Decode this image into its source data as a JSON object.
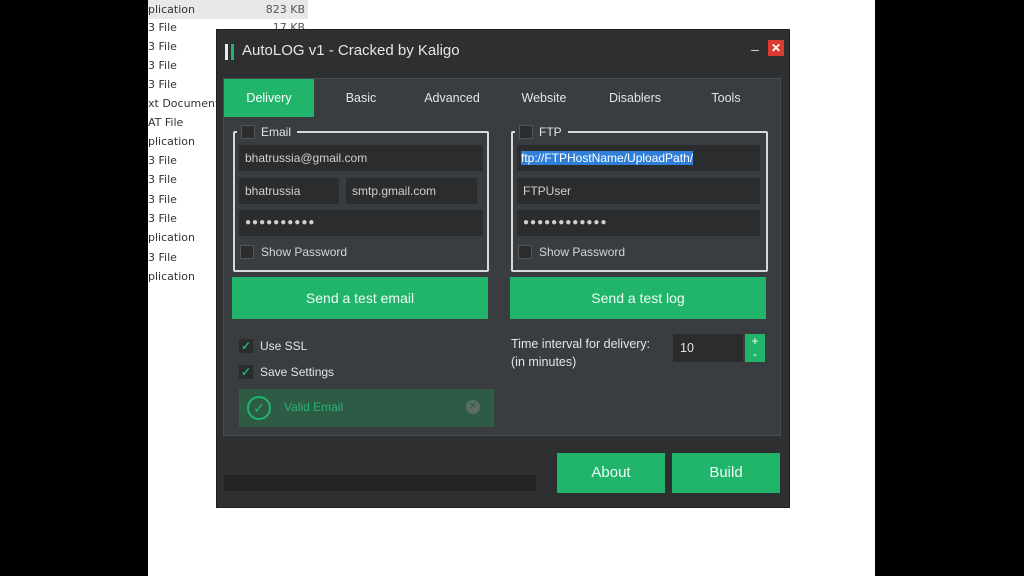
{
  "explorer": {
    "rows": [
      {
        "name": "plication",
        "size": "823 KB"
      },
      {
        "name": "3 File",
        "size": "17 KB"
      },
      {
        "name": "3 File",
        "size": ""
      },
      {
        "name": "3 File",
        "size": ""
      },
      {
        "name": "3 File",
        "size": ""
      },
      {
        "name": "xt Document",
        "size": ""
      },
      {
        "name": "AT File",
        "size": ""
      },
      {
        "name": "plication",
        "size": ""
      },
      {
        "name": "3 File",
        "size": ""
      },
      {
        "name": "3 File",
        "size": ""
      },
      {
        "name": "3 File",
        "size": ""
      },
      {
        "name": "3 File",
        "size": ""
      },
      {
        "name": "plication",
        "size": ""
      },
      {
        "name": "3 File",
        "size": ""
      },
      {
        "name": "plication",
        "size": ""
      }
    ]
  },
  "window": {
    "title": "AutoLOG v1 - Cracked by Kaligo",
    "minimize_glyph": "–",
    "close_glyph": "✕"
  },
  "tabs": [
    "Delivery",
    "Basic",
    "Advanced",
    "Website",
    "Disablers",
    "Tools"
  ],
  "email": {
    "legend": "Email",
    "address": "bhatrussia@gmail.com",
    "username": "bhatrussia",
    "smtp": "smtp.gmail.com",
    "password_mask": "●●●●●●●●●●",
    "show_password": "Show Password",
    "test_button": "Send a test email"
  },
  "ftp": {
    "legend": "FTP",
    "host": "ftp://FTPHostName/UploadPath/",
    "user": "FTPUser",
    "password_mask": "●●●●●●●●●●●●",
    "show_password": "Show Password",
    "test_button": "Send a test log"
  },
  "options": {
    "use_ssl": "Use SSL",
    "save_settings": "Save Settings",
    "check_glyph": "✓"
  },
  "status": {
    "valid_email": "Valid Email",
    "valid_icon": "✓",
    "dismiss_icon": "✕"
  },
  "interval": {
    "label_line1": "Time interval for delivery:",
    "label_line2": "(in minutes)",
    "value": "10",
    "plus": "+",
    "minus": "-"
  },
  "footer": {
    "about": "About",
    "build": "Build"
  },
  "colors": {
    "accent": "#21b56c",
    "window_bg": "#2d2f31",
    "panel_bg": "#3a3d40",
    "close": "#d93a32"
  }
}
